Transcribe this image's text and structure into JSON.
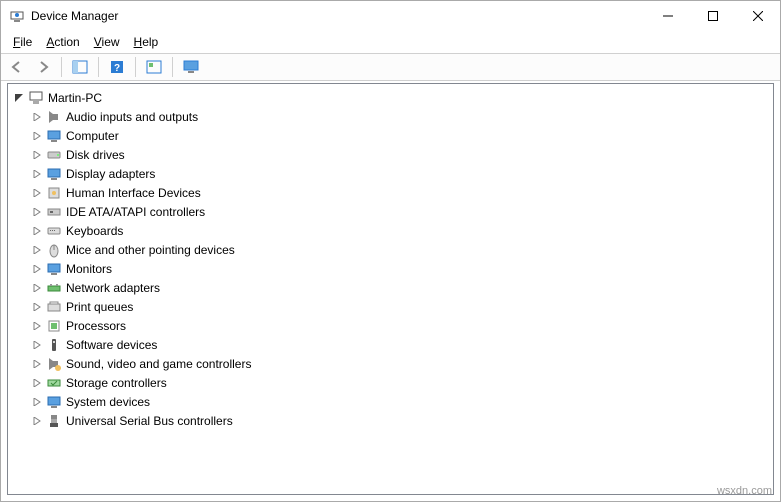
{
  "title": "Device Manager",
  "menu": {
    "file": "File",
    "action": "Action",
    "view": "View",
    "help": "Help"
  },
  "tree": {
    "root": "Martin-PC",
    "items": [
      "Audio inputs and outputs",
      "Computer",
      "Disk drives",
      "Display adapters",
      "Human Interface Devices",
      "IDE ATA/ATAPI controllers",
      "Keyboards",
      "Mice and other pointing devices",
      "Monitors",
      "Network adapters",
      "Print queues",
      "Processors",
      "Software devices",
      "Sound, video and game controllers",
      "Storage controllers",
      "System devices",
      "Universal Serial Bus controllers"
    ]
  },
  "watermark": "wsxdn.com"
}
